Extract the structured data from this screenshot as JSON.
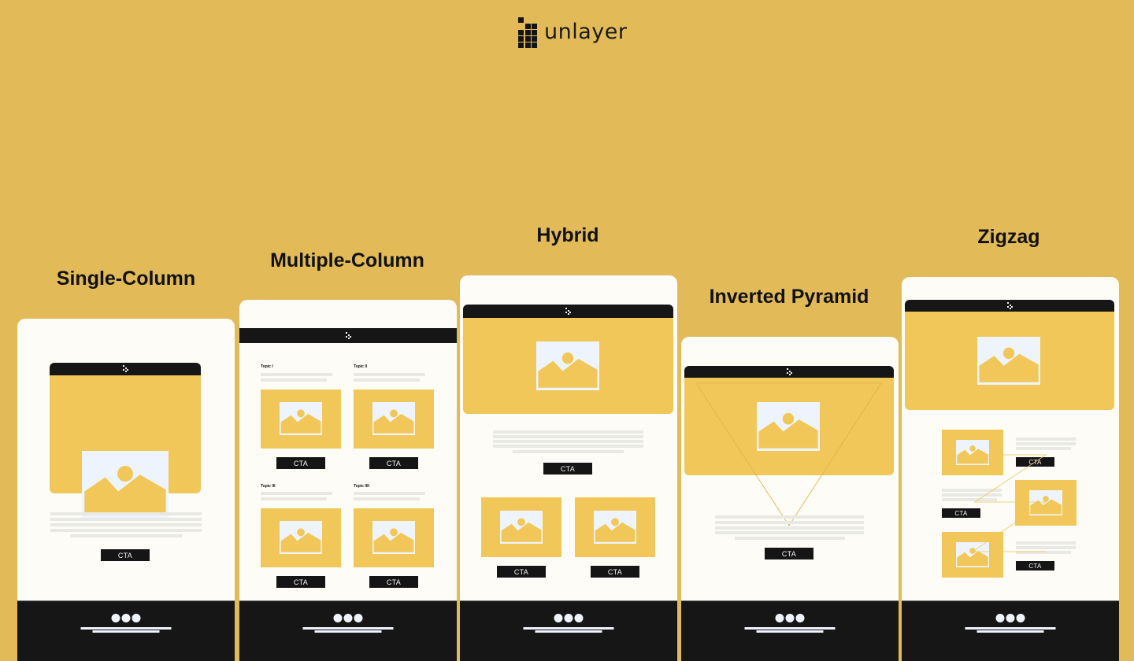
{
  "brand": {
    "name": "unlayer",
    "icon": "unlayer-logo-icon"
  },
  "colors": {
    "background": "#e2bb58",
    "card": "#fdfcf6",
    "hero": "#f1c75a",
    "dark": "#161616",
    "image_placeholder": "#eef4fd",
    "text_line": "#e8e8e4"
  },
  "layouts": [
    {
      "title": "Single-Column",
      "cta_labels": [
        "CTA"
      ],
      "icons": [
        "image-placeholder-icon",
        "mini-logo-icon",
        "footer-dots-icon"
      ]
    },
    {
      "title": "Multiple-Column",
      "topics": [
        "Topic I",
        "Topic II",
        "Topic III",
        "Topic IIII"
      ],
      "cta_labels": [
        "CTA",
        "CTA",
        "CTA",
        "CTA"
      ]
    },
    {
      "title": "Hybrid",
      "cta_labels": [
        "CTA",
        "CTA",
        "CTA"
      ]
    },
    {
      "title": "Inverted Pyramid",
      "cta_labels": [
        "CTA"
      ]
    },
    {
      "title": "Zigzag",
      "cta_labels": [
        "CTA",
        "CTA",
        "CTA"
      ]
    }
  ]
}
